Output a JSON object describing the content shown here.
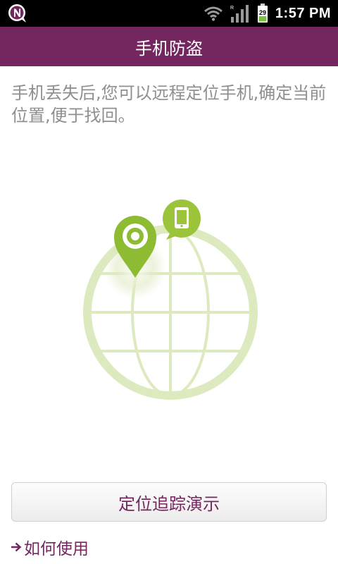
{
  "status_bar": {
    "time": "1:57 PM",
    "battery_level": "29",
    "roaming_indicator": "R",
    "icons": [
      "app-n-icon",
      "wifi-icon",
      "signal-icon",
      "battery-icon"
    ]
  },
  "header": {
    "title": "手机防盗"
  },
  "main": {
    "description": "手机丢失后,您可以远程定位手机,确定当前位置,便于找回。",
    "illustration_icons": [
      "globe-icon",
      "location-pin-icon",
      "phone-bubble-icon"
    ]
  },
  "actions": {
    "demo_button_label": "定位追踪演示",
    "howto_link_label": "如何使用"
  },
  "colors": {
    "brand": "#74275f",
    "globe": "#dde9bf",
    "pin": "#8dbb32"
  }
}
